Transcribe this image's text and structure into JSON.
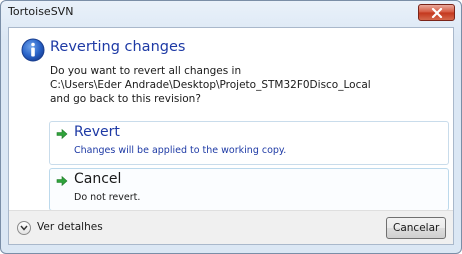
{
  "window": {
    "title": "TortoiseSVN"
  },
  "dialog": {
    "heading": "Reverting changes",
    "message_lines": [
      "Do you want to revert all changes in",
      "C:\\Users\\Eder Andrade\\Desktop\\Projeto_STM32F0Disco_Local",
      "and go back to this revision?"
    ],
    "options": [
      {
        "title": "Revert",
        "subtitle": "Changes will be applied to the working copy."
      },
      {
        "title": "Cancel",
        "subtitle": "Do not revert."
      }
    ]
  },
  "footer": {
    "details_label": "Ver detalhes",
    "cancel_label": "Cancelar"
  },
  "icons": {
    "dialog": "info-icon",
    "option": "green-arrow-icon",
    "expand": "chevron-down-icon",
    "close": "close-icon"
  },
  "colors": {
    "heading": "#1e3aa5",
    "arrow": "#2fa33b",
    "close_button": "#c3361c"
  }
}
